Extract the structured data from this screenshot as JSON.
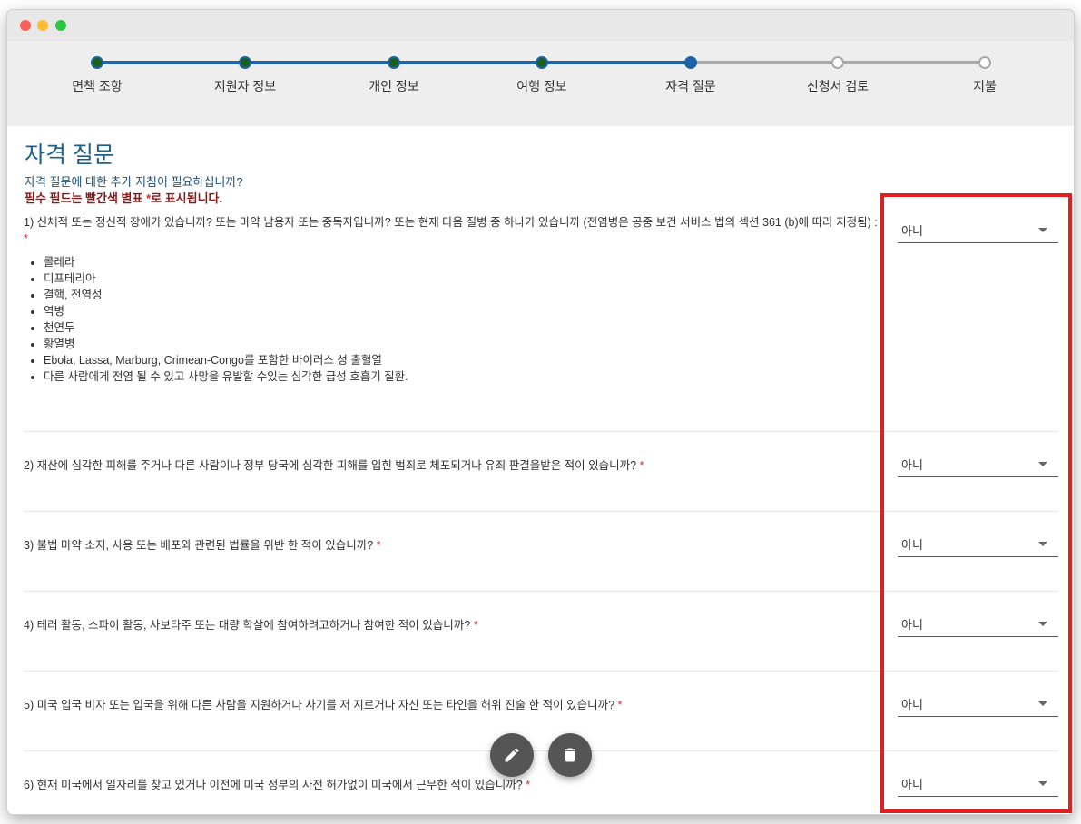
{
  "stepper": {
    "steps": [
      {
        "label": "면책 조항",
        "state": "done"
      },
      {
        "label": "지원자 정보",
        "state": "done"
      },
      {
        "label": "개인 정보",
        "state": "done"
      },
      {
        "label": "여행 정보",
        "state": "done"
      },
      {
        "label": "자격 질문",
        "state": "current"
      },
      {
        "label": "신청서 검토",
        "state": "todo"
      },
      {
        "label": "지불",
        "state": "todo"
      }
    ],
    "colors": {
      "done_line": "#1f63a8",
      "todo_line": "#a9a9a9",
      "done_dot": "#1b5e20"
    }
  },
  "page": {
    "title": "자격 질문",
    "help_text": "자격 질문에 대한 추가 지침이 필요하십니까?",
    "required_note": "필수 필드는 빨간색 별표 ",
    "required_star": "*",
    "required_note_suffix": "로 표시됩니다."
  },
  "questions": [
    {
      "text": "1) 신체적 또는 정신적 장애가 있습니까? 또는 마약 남용자 또는 중독자입니까? 또는 현재 다음 질병 중 하나가 있습니까 (전염병은 공중 보건 서비스 법의 섹션 361 (b)에 따라 지정됨) :",
      "star": "*",
      "items": [
        "콜레라",
        "디프테리아",
        "결핵, 전염성",
        "역병",
        "천연두",
        "황열병",
        "Ebola, Lassa, Marburg, Crimean-Congo를 포함한 바이러스 성 출혈열",
        "다른 사람에게 전염 될 수 있고 사망을 유발할 수있는 심각한 급성 호흡기 질환."
      ],
      "answer": "아니"
    },
    {
      "text": "2) 재산에 심각한 피해를 주거나 다른 사람이나 정부 당국에 심각한 피해를 입힌 범죄로 체포되거나 유죄 판결을받은 적이 있습니까?",
      "star": "*",
      "answer": "아니"
    },
    {
      "text": "3) 불법 마약 소지, 사용 또는 배포와 관련된 법률을 위반 한 적이 있습니까?",
      "star": "*",
      "answer": "아니"
    },
    {
      "text": "4) 테러 활동, 스파이 활동, 사보타주 또는 대량 학살에 참여하려고하거나 참여한 적이 있습니까?",
      "star": "*",
      "answer": "아니"
    },
    {
      "text": "5) 미국 입국 비자 또는 입국을 위해 다른 사람을 지원하거나 사기를 저 지르거나 자신 또는 타인을 허위 진술 한 적이 있습니까?",
      "star": "*",
      "answer": "아니"
    },
    {
      "text": "6) 현재 미국에서 일자리를 찾고 있거나 이전에 미국 정부의 사전 허가없이 미국에서 근무한 적이 있습니까?",
      "star": "*",
      "answer": "아니"
    }
  ],
  "fabs": {
    "edit_icon": "pencil-icon",
    "delete_icon": "trash-icon"
  },
  "highlight_color": "#e02020"
}
